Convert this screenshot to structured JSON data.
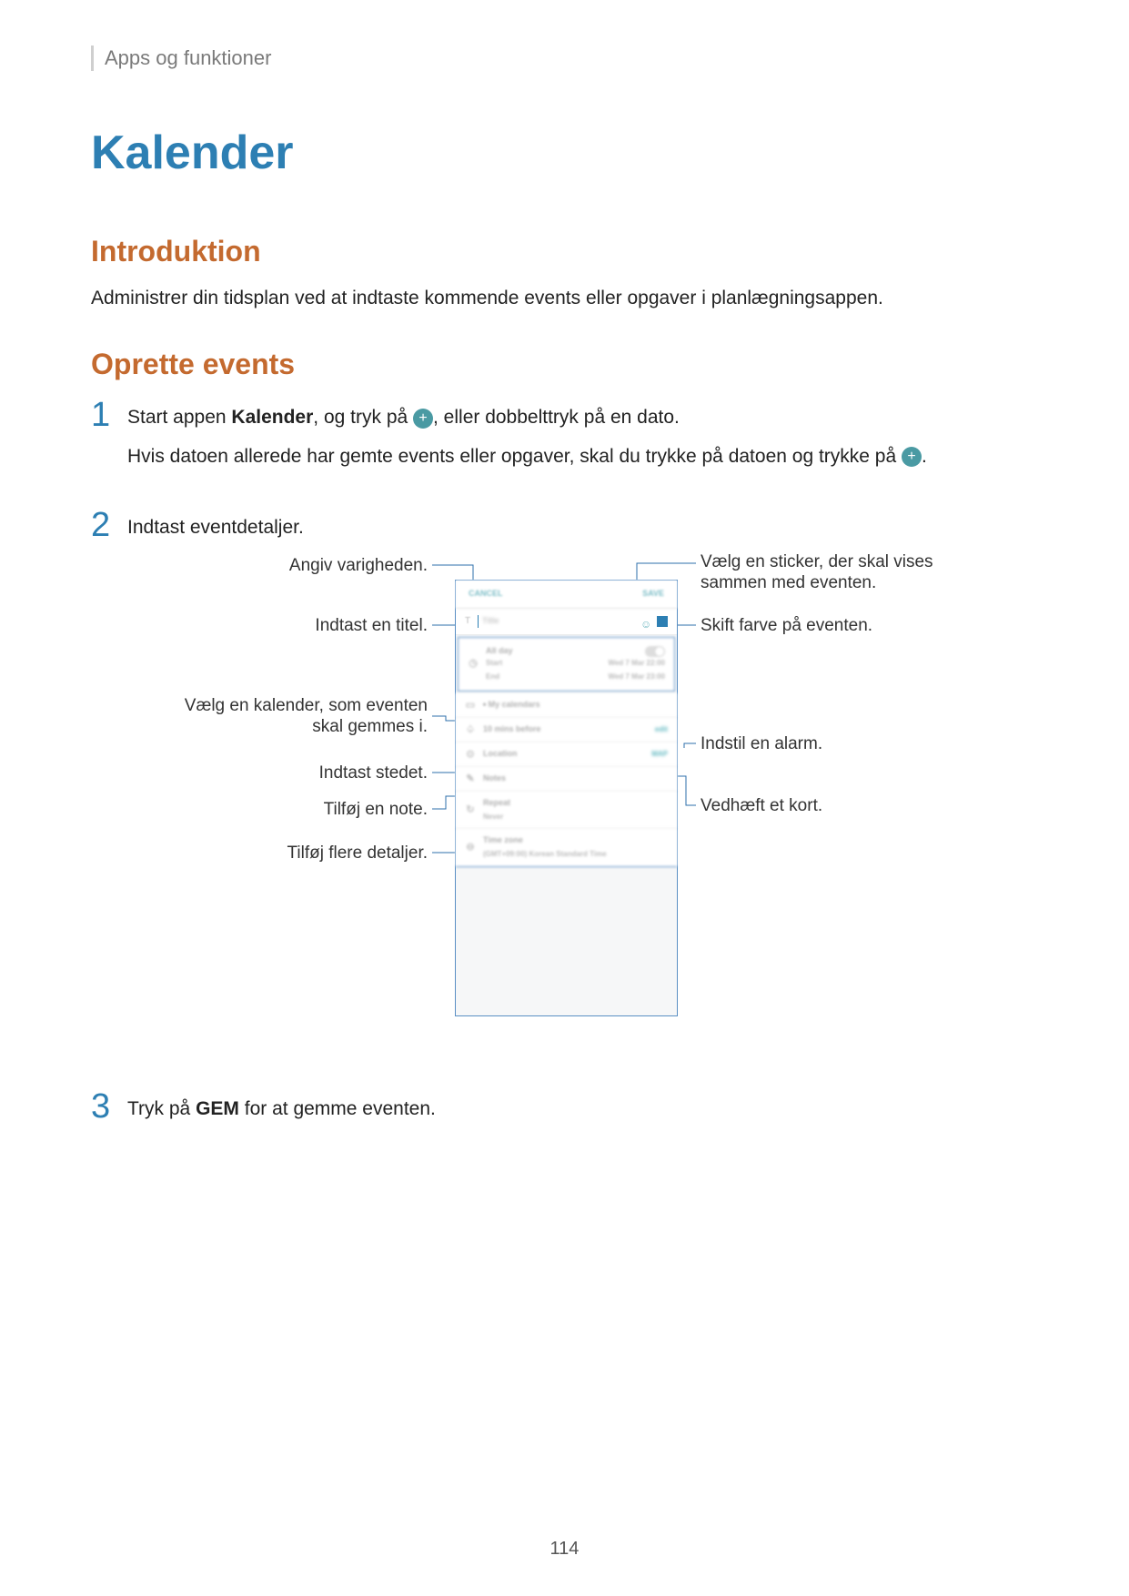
{
  "breadcrumb": "Apps og funktioner",
  "title": "Kalender",
  "section_intro_heading": "Introduktion",
  "section_intro_body": "Administrer din tidsplan ved at indtaste kommende events eller opgaver i planlægningsappen.",
  "section_create_heading": "Oprette events",
  "steps": {
    "s1": {
      "num": "1",
      "part_a": "Start appen ",
      "app_name": "Kalender",
      "part_b": ", og tryk på ",
      "part_c": ", eller dobbelttryk på en dato.",
      "line2_a": "Hvis datoen allerede har gemte events eller opgaver, skal du trykke på datoen og trykke på ",
      "line2_b": "."
    },
    "s2": {
      "num": "2",
      "text": "Indtast eventdetaljer."
    },
    "s3": {
      "num": "3",
      "part_a": "Tryk på ",
      "gem": "GEM",
      "part_b": " for at gemme eventen."
    }
  },
  "callouts": {
    "left": {
      "duration": "Angiv varigheden.",
      "title": "Indtast en titel.",
      "calendar_a": "Vælg en kalender, som eventen",
      "calendar_b": "skal gemmes i.",
      "location": "Indtast stedet.",
      "note": "Tilføj en note.",
      "details": "Tilføj flere detaljer."
    },
    "right": {
      "sticker_a": "Vælg en sticker, der skal vises",
      "sticker_b": "sammen med eventen.",
      "color": "Skift farve på eventen.",
      "alarm": "Indstil en alarm.",
      "map": "Vedhæft et kort."
    }
  },
  "phone": {
    "cancel": "CANCEL",
    "save": "SAVE",
    "title_letter": "T",
    "title_placeholder": "Title",
    "allday": "All day",
    "start": "Start",
    "end": "End",
    "start_val": "Wed 7 Mar   22:00",
    "end_val": "Wed 7 Mar   23:00",
    "my_calendars": "My calendars",
    "reminder": "10 mins before",
    "reminder_badge": "edit",
    "location": "Location",
    "map_badge": "MAP",
    "notes": "Notes",
    "repeat": "Repeat",
    "repeat_val": "Never",
    "timezone": "Time zone",
    "timezone_val": "(GMT+09:00) Korean Standard Time"
  },
  "page_number": "114"
}
